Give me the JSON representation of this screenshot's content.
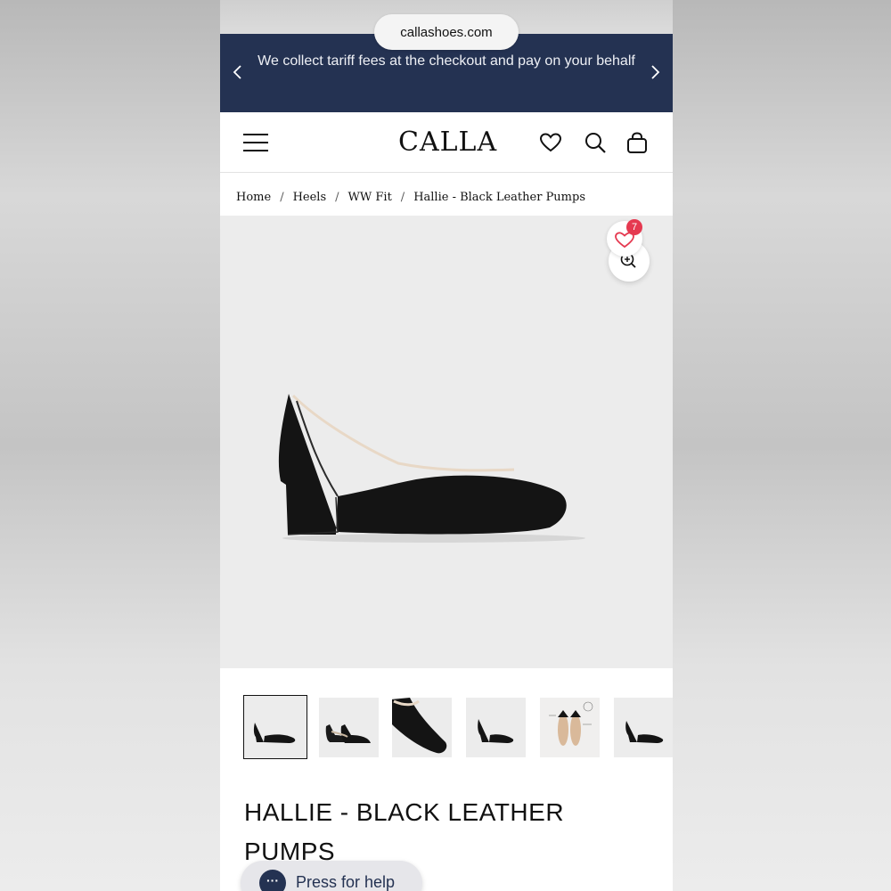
{
  "browser": {
    "url": "callashoes.com"
  },
  "banner": {
    "text": "We collect tariff fees at the checkout and pay on your behalf",
    "prev_icon": "chevron-left-icon",
    "next_icon": "chevron-right-icon",
    "background_color": "#243252"
  },
  "header": {
    "logo": "CALLA",
    "icons": [
      "menu-icon",
      "heart-icon",
      "search-icon",
      "bag-icon"
    ]
  },
  "breadcrumb": {
    "items": [
      "Home",
      "Heels",
      "WW Fit",
      "Hallie - Black Leather Pumps"
    ],
    "separator": "/"
  },
  "gallery": {
    "wishlist_count": "7",
    "badge_color": "#e53950",
    "zoom_icon": "zoom-in-icon",
    "thumbnail_count": 6
  },
  "product": {
    "title": "HALLIE - BLACK LEATHER PUMPS"
  },
  "help": {
    "label": "Press for help",
    "icon": "chat-dots-icon"
  }
}
